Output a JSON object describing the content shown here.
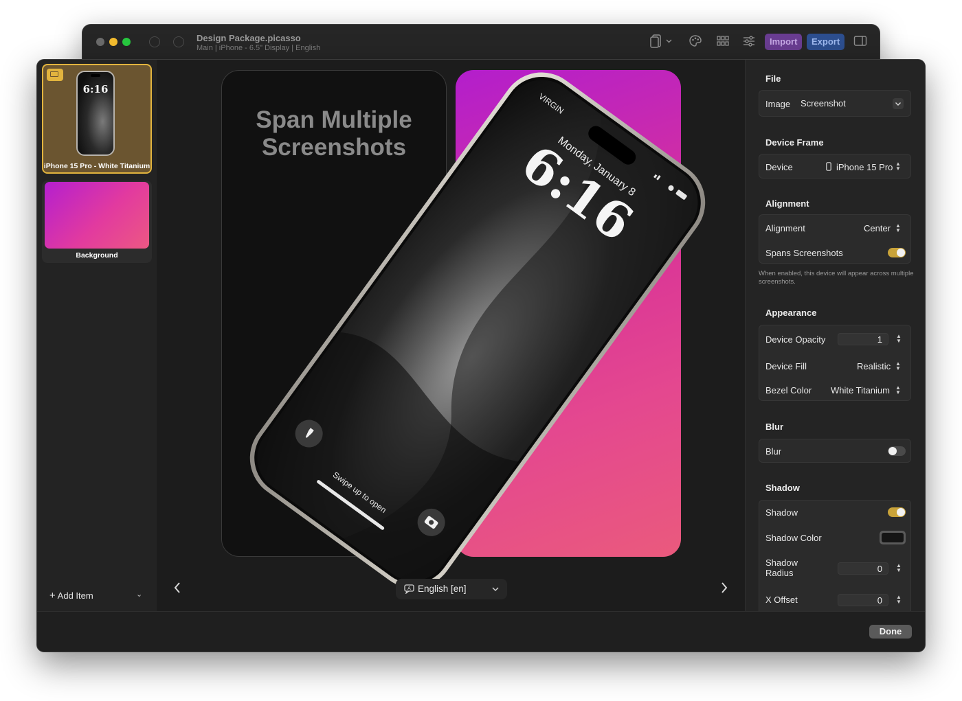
{
  "window": {
    "title": "Design Package.picasso",
    "subtitle": "Main | iPhone - 6.5\" Display | English",
    "toolbar": {
      "import_label": "Import",
      "export_label": "Export",
      "icons": [
        "undo-icon",
        "redo-icon",
        "device-icon",
        "palette-icon",
        "grid-icon",
        "sliders-icon",
        "sidebar-right-icon"
      ]
    }
  },
  "sidebar": {
    "items": [
      {
        "label": "iPhone 15 Pro - White Titanium",
        "thumb_time": "6:16",
        "selected": true
      },
      {
        "label": "Background",
        "selected": false
      }
    ],
    "add_item_label": "Add Item"
  },
  "canvas": {
    "headline_line1": "Span Multiple",
    "headline_line2": "Screenshots",
    "lockscreen": {
      "carrier": "VIRGIN",
      "date": "Monday, January 8",
      "time": "6:16",
      "swipe_hint": "Swipe up to open"
    },
    "language_label": "English [en]",
    "colors": {
      "gradient_start": "#b31ecc",
      "gradient_end": "#ea5a7d"
    }
  },
  "inspector": {
    "file": {
      "title": "File",
      "image_label": "Image",
      "image_value": "Screenshot"
    },
    "device_frame": {
      "title": "Device Frame",
      "device_label": "Device",
      "device_value": "iPhone 15 Pro"
    },
    "alignment": {
      "title": "Alignment",
      "alignment_label": "Alignment",
      "alignment_value": "Center",
      "spans_label": "Spans Screenshots",
      "spans_on": true,
      "hint": "When enabled, this device will appear across multiple screenshots."
    },
    "appearance": {
      "title": "Appearance",
      "opacity_label": "Device Opacity",
      "opacity_value": "1",
      "fill_label": "Device Fill",
      "fill_value": "Realistic",
      "bezel_label": "Bezel Color",
      "bezel_value": "White Titanium"
    },
    "blur": {
      "title": "Blur",
      "blur_label": "Blur",
      "blur_on": false
    },
    "shadow": {
      "title": "Shadow",
      "shadow_label": "Shadow",
      "shadow_on": true,
      "color_label": "Shadow Color",
      "color_value": "#151515",
      "radius_label_1": "Shadow",
      "radius_label_2": "Radius",
      "radius_value": "0",
      "xoffset_label": "X Offset",
      "xoffset_value": "0"
    },
    "accent_color": "#c9a339"
  },
  "footer": {
    "done_label": "Done"
  }
}
